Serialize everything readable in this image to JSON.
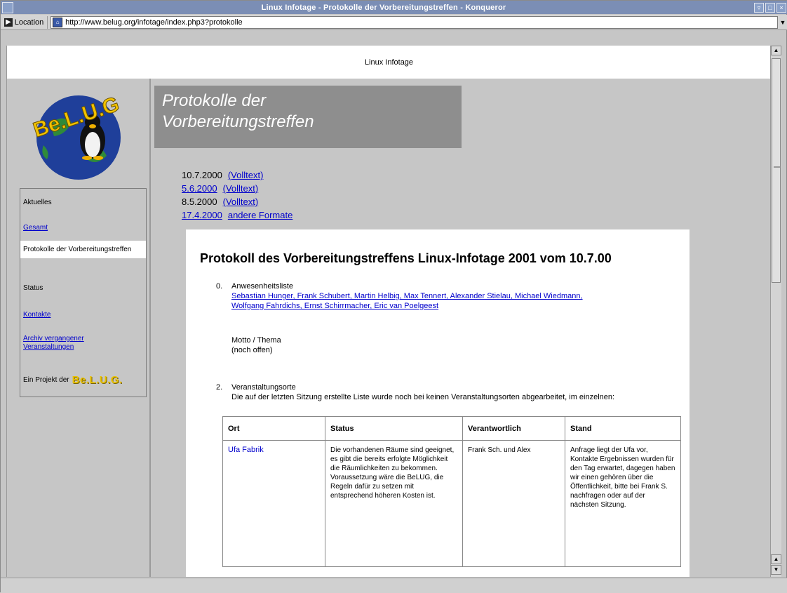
{
  "window": {
    "title": "Linux Infotage - Protokolle der Vorbereitungstreffen - Konqueror",
    "buttons": [
      "▿",
      "□",
      "×"
    ]
  },
  "location": {
    "label": "Location",
    "url": "http://www.belug.org/infotage/index.php3?protokolle"
  },
  "page": {
    "header": "Linux Infotage",
    "banner_line1": "Protokolle der",
    "banner_line2": "Vorbereitungstreffen"
  },
  "sidebar": {
    "logo_text": "Be.L.U.G",
    "items": [
      {
        "label": "Aktuelles",
        "link": false
      },
      {
        "label": "Gesamt",
        "link": true
      },
      {
        "label": "Protokolle der Vorbereitungstreffen",
        "link": false
      },
      {
        "label": "Status",
        "link": false
      },
      {
        "label": "Kontakte",
        "link": true
      },
      {
        "label": "Archiv vergangener Veranstaltungen",
        "link": true
      }
    ],
    "sponsor_label": "Ein Projekt der",
    "sponsor_logo": "Be.L.U.G."
  },
  "dates": [
    {
      "date": "10.7.2000",
      "date_link": false,
      "fmt": "(Volltext)"
    },
    {
      "date": "5.6.2000",
      "date_link": true,
      "fmt": "(Volltext)"
    },
    {
      "date": "8.5.2000",
      "date_link": false,
      "fmt": "(Volltext)"
    },
    {
      "date": "17.4.2000",
      "date_link": true,
      "fmt": "andere Formate"
    }
  ],
  "protocol": {
    "title": "Protokoll des Vorbereitungstreffens Linux-Infotage 2001 vom 10.7.00",
    "s0_num": "0.",
    "s0_heading": "Anwesenheitsliste",
    "s0_names_line1": "Sebastian Hunger, Frank Schubert, Martin Helbig, Max Tennert, Alexander Stielau, Michael Wiedmann,",
    "s0_names_line2": "Wolfgang Fahrdichs, Ernst Schirrmacher, Eric van Poelgeest",
    "s1_heading": "Motto / Thema",
    "s1_text": "(noch offen)",
    "s2_num": "2.",
    "s2_heading": "Veranstaltungsorte",
    "s2_text": "Die auf der letzten Sitzung erstellte Liste wurde noch bei keinen Veranstaltungsorten abgearbeitet, im einzelnen:"
  },
  "table": {
    "headers": [
      "Ort",
      "Status",
      "Verantwortlich",
      "Stand"
    ],
    "rows": [
      {
        "ort": "Ufa Fabrik",
        "status": "Die vorhandenen Räume sind geeignet, es gibt die bereits erfolgte Möglichkeit die Räumlichkeiten zu bekommen. Voraussetzung wäre die BeLUG, die Regeln dafür zu setzen mit entsprechend höheren Kosten ist.",
        "verantwortlich": "Frank Sch. und Alex",
        "stand": "Anfrage liegt der Ufa vor, Kontakte Ergebnissen wurden für den Tag erwartet, dagegen haben wir einen gehören über die Öffentlichkeit, bitte bei Frank S. nachfragen oder auf der nächsten Sitzung."
      }
    ]
  }
}
